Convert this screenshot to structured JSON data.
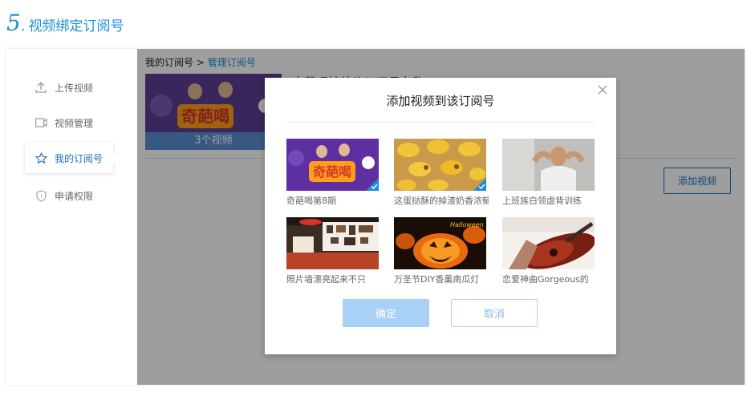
{
  "step": {
    "number": "5",
    "dot": ".",
    "title": "视频绑定订阅号"
  },
  "sidebar": {
    "items": [
      {
        "label": "上传视频",
        "icon": "upload-icon"
      },
      {
        "label": "视频管理",
        "icon": "video-icon"
      },
      {
        "label": "我的订阅号",
        "icon": "star-icon",
        "active": true
      },
      {
        "label": "申请权限",
        "icon": "shield-icon"
      }
    ]
  },
  "main": {
    "breadcrumb": {
      "root": "我的订阅号",
      "sep": ">",
      "current": "管理订阅号"
    },
    "channel": {
      "count": "3个视频",
      "name": "奇葩喝妙处头订阅号名称"
    },
    "add_video_label": "添加视频"
  },
  "modal": {
    "title": "添加视频到该订阅号",
    "videos": [
      {
        "caption": "奇葩喝第8期",
        "selected": true
      },
      {
        "caption": "这蛋挞酥的掉渣奶香浓郁",
        "selected": true
      },
      {
        "caption": "上班族白领虐背训练",
        "selected": false
      },
      {
        "caption": "照片墙漂亮起来不只",
        "selected": false
      },
      {
        "caption": "万圣节DIY香薰南瓜灯",
        "selected": false
      },
      {
        "caption": "恋爱神曲Gorgeous的",
        "selected": false
      }
    ],
    "ok_label": "确定",
    "cancel_label": "取消"
  },
  "colors": {
    "accent": "#1b8fd8",
    "button_light": "#a9d0f5",
    "overlay": "rgba(0,0,0,0.38)"
  }
}
